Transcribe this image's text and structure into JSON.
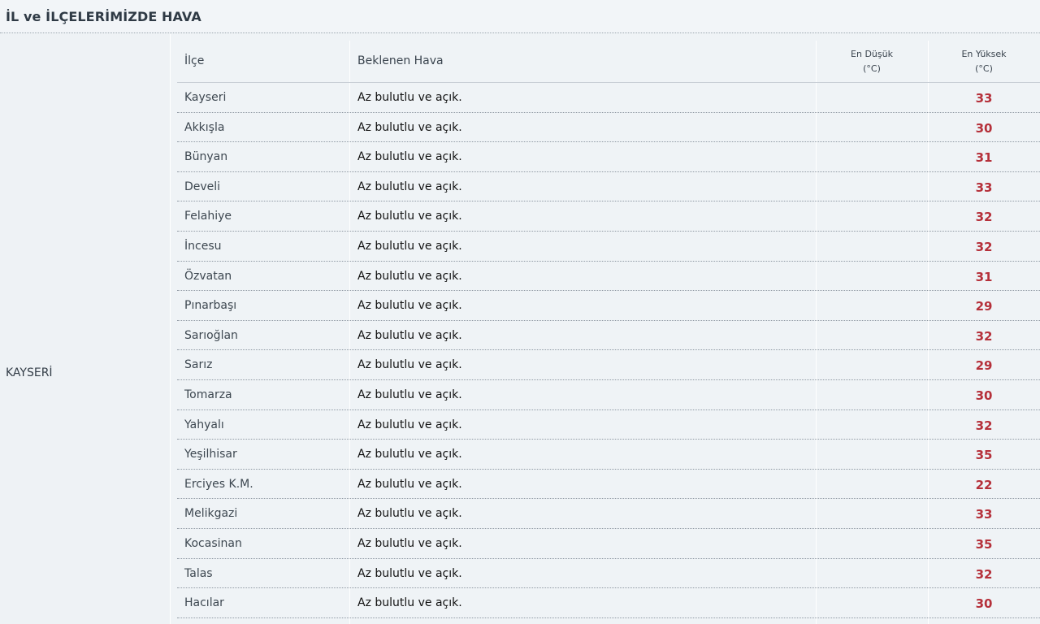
{
  "header": {
    "title": "İL ve İLÇELERİMİZDE HAVA"
  },
  "province": "KAYSERİ",
  "table": {
    "columns": {
      "district": "İlçe",
      "weather": "Beklenen Hava",
      "low_line1": "En Düşük",
      "low_line2": "(°C)",
      "high_line1": "En Yüksek",
      "high_line2": "(°C)"
    },
    "rows": [
      {
        "district": "Kayseri",
        "weather": "Az bulutlu ve açık.",
        "low": "",
        "high": "33"
      },
      {
        "district": "Akkışla",
        "weather": "Az bulutlu ve açık.",
        "low": "",
        "high": "30"
      },
      {
        "district": "Bünyan",
        "weather": "Az bulutlu ve açık.",
        "low": "",
        "high": "31"
      },
      {
        "district": "Develi",
        "weather": "Az bulutlu ve açık.",
        "low": "",
        "high": "33"
      },
      {
        "district": "Felahiye",
        "weather": "Az bulutlu ve açık.",
        "low": "",
        "high": "32"
      },
      {
        "district": "İncesu",
        "weather": "Az bulutlu ve açık.",
        "low": "",
        "high": "32"
      },
      {
        "district": "Özvatan",
        "weather": "Az bulutlu ve açık.",
        "low": "",
        "high": "31"
      },
      {
        "district": "Pınarbaşı",
        "weather": "Az bulutlu ve açık.",
        "low": "",
        "high": "29"
      },
      {
        "district": "Sarıoğlan",
        "weather": "Az bulutlu ve açık.",
        "low": "",
        "high": "32"
      },
      {
        "district": "Sarız",
        "weather": "Az bulutlu ve açık.",
        "low": "",
        "high": "29"
      },
      {
        "district": "Tomarza",
        "weather": "Az bulutlu ve açık.",
        "low": "",
        "high": "30"
      },
      {
        "district": "Yahyalı",
        "weather": "Az bulutlu ve açık.",
        "low": "",
        "high": "32"
      },
      {
        "district": "Yeşilhisar",
        "weather": "Az bulutlu ve açık.",
        "low": "",
        "high": "35"
      },
      {
        "district": "Erciyes K.M.",
        "weather": "Az bulutlu ve açık.",
        "low": "",
        "high": "22"
      },
      {
        "district": "Melikgazi",
        "weather": "Az bulutlu ve açık.",
        "low": "",
        "high": "33"
      },
      {
        "district": "Kocasinan",
        "weather": "Az bulutlu ve açık.",
        "low": "",
        "high": "35"
      },
      {
        "district": "Talas",
        "weather": "Az bulutlu ve açık.",
        "low": "",
        "high": "32"
      },
      {
        "district": "Hacılar",
        "weather": "Az bulutlu ve açık.",
        "low": "",
        "high": "30"
      }
    ]
  },
  "colors": {
    "high_temp": "#b5303a",
    "background": "#eff3f6"
  }
}
